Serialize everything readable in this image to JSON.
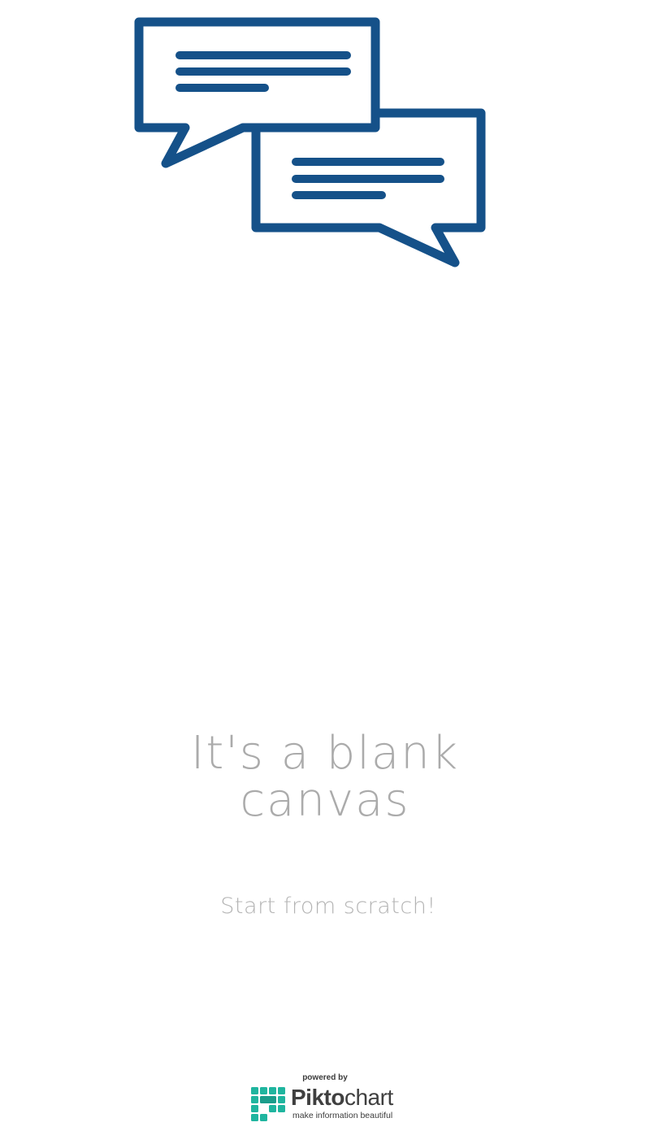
{
  "illustration": {
    "icon": "chat-bubbles-icon",
    "color": "#155189"
  },
  "headline": {
    "line1": "It's a blank",
    "line2": "canvas"
  },
  "subheadline": "Start from scratch!",
  "branding": {
    "powered_by": "powered by",
    "name_bold": "Pikto",
    "name_light": "chart",
    "tagline": "make information beautiful",
    "logo_icon": "piktochart-logo-icon",
    "logo_color": "#1fb59f"
  }
}
